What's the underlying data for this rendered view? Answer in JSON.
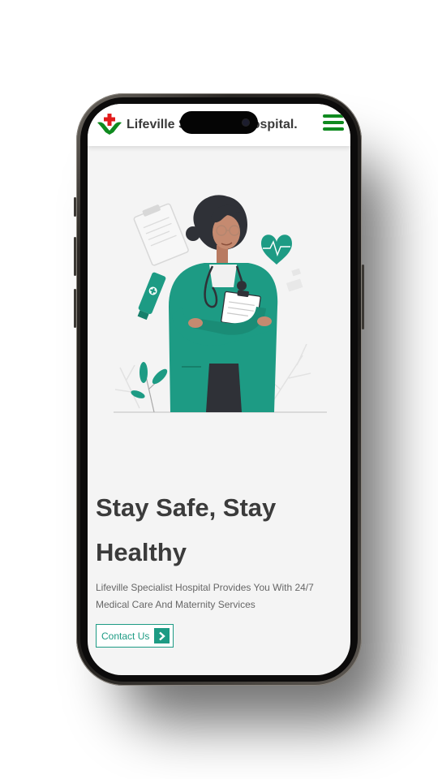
{
  "header": {
    "brand_name": "Lifeville Specialist Hospital.",
    "logo_icon": "medical-cross-logo-icon",
    "menu_icon": "hamburger-menu-icon"
  },
  "hero": {
    "illustration": "doctor-illustration",
    "title": "Stay Safe, Stay Healthy",
    "description": "Lifeville Specialist Hospital Provides You With 24/7 Medical Care And Maternity Services",
    "cta_label": "Contact Us",
    "cta_icon": "chevron-right-icon"
  },
  "colors": {
    "accent": "#1d9b84",
    "brand_green": "#0f8a1f",
    "logo_red": "#e21b1b",
    "text_dark": "#3b3b3b",
    "screen_bg": "#f4f4f4"
  }
}
